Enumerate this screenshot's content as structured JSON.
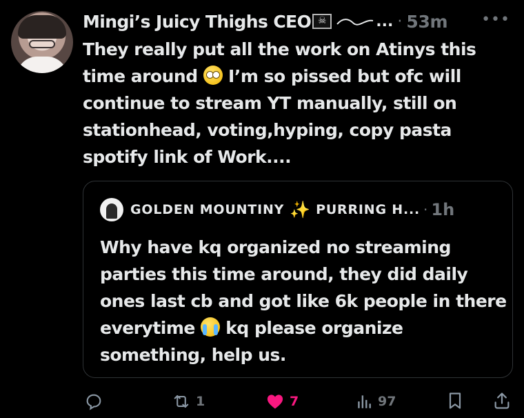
{
  "tweet": {
    "author_name": "Mingi’s Juicy Thighs CEO",
    "flag_icon": "pirate-flag-icon",
    "truncation": "...",
    "separator": "·",
    "time": "53m",
    "more_icon": "more-horizontal-icon",
    "text_part1": "They really put all the work on Atinys this time around ",
    "emoji1": "face-with-rolling-eyes-icon",
    "text_part2": " I’m so pissed but ofc will continue to stream YT manually, still on stationhead, voting,hyping, copy pasta spotify link of Work...."
  },
  "quote": {
    "author_name": "GOLDEN MOUNTINY",
    "sparkle_icon": "sparkles-icon",
    "author_name2": "PURRING H...",
    "separator": "·",
    "time": "1h",
    "text_part1": "Why have kq organized no streaming parties this time around, they did daily ones last cb and got like 6k people in there everytime ",
    "emoji": "loudly-crying-face-icon",
    "text_part2": " kq please organize something, help us."
  },
  "actions": {
    "replies": "",
    "retweets": "1",
    "likes": "7",
    "views": "97"
  },
  "colors": {
    "background": "#000000",
    "text": "#e7e9ea",
    "muted": "#71767b",
    "like": "#f91880",
    "border": "#2f3336"
  }
}
